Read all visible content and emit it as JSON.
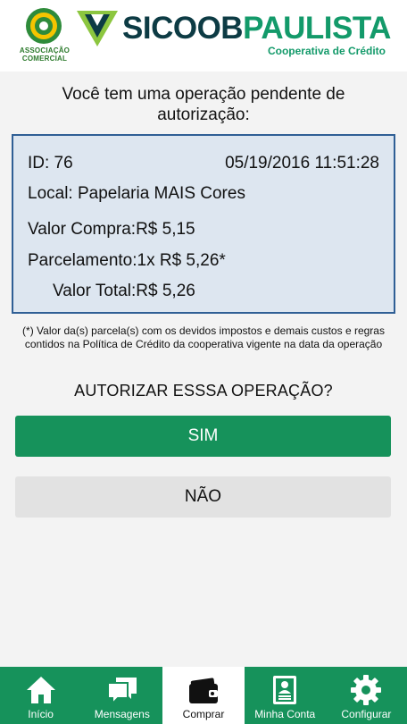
{
  "header": {
    "assoc_line1": "ASSOCIAÇÃO",
    "assoc_line2": "COMERCIAL",
    "brand_part1": "SICOOB",
    "brand_part2": "PAULISTA",
    "brand_sub": "Cooperativa de Crédito"
  },
  "main": {
    "title": "Você tem uma operação pendente de autorização:",
    "operation": {
      "id": "ID:  76",
      "datetime": "05/19/2016 11:51:28",
      "local": "Local:  Papelaria MAIS Cores",
      "valor_compra": "Valor Compra:R$ 5,15",
      "parcelamento": "Parcelamento:1x R$ 5,26*",
      "valor_total": "Valor Total:R$ 5,26"
    },
    "note": "(*) Valor da(s) parcela(s) com os devidos impostos e demais custos e regras contidos na Política de Crédito da cooperativa vigente na data da operação",
    "question": "AUTORIZAR ESSSA OPERAÇÃO?",
    "yes_label": "SIM",
    "no_label": "NÃO"
  },
  "nav": {
    "items": [
      {
        "label": "Início",
        "icon": "home-icon"
      },
      {
        "label": "Mensagens",
        "icon": "messages-icon"
      },
      {
        "label": "Comprar",
        "icon": "wallet-icon"
      },
      {
        "label": "Minha Conta",
        "icon": "account-icon"
      },
      {
        "label": "Configurar",
        "icon": "gear-icon"
      }
    ],
    "active": "Comprar"
  },
  "colors": {
    "brand_green": "#16925b",
    "brand_dark": "#0d3b44",
    "box_border": "#2f5f95",
    "box_fill": "#dde6f0"
  }
}
